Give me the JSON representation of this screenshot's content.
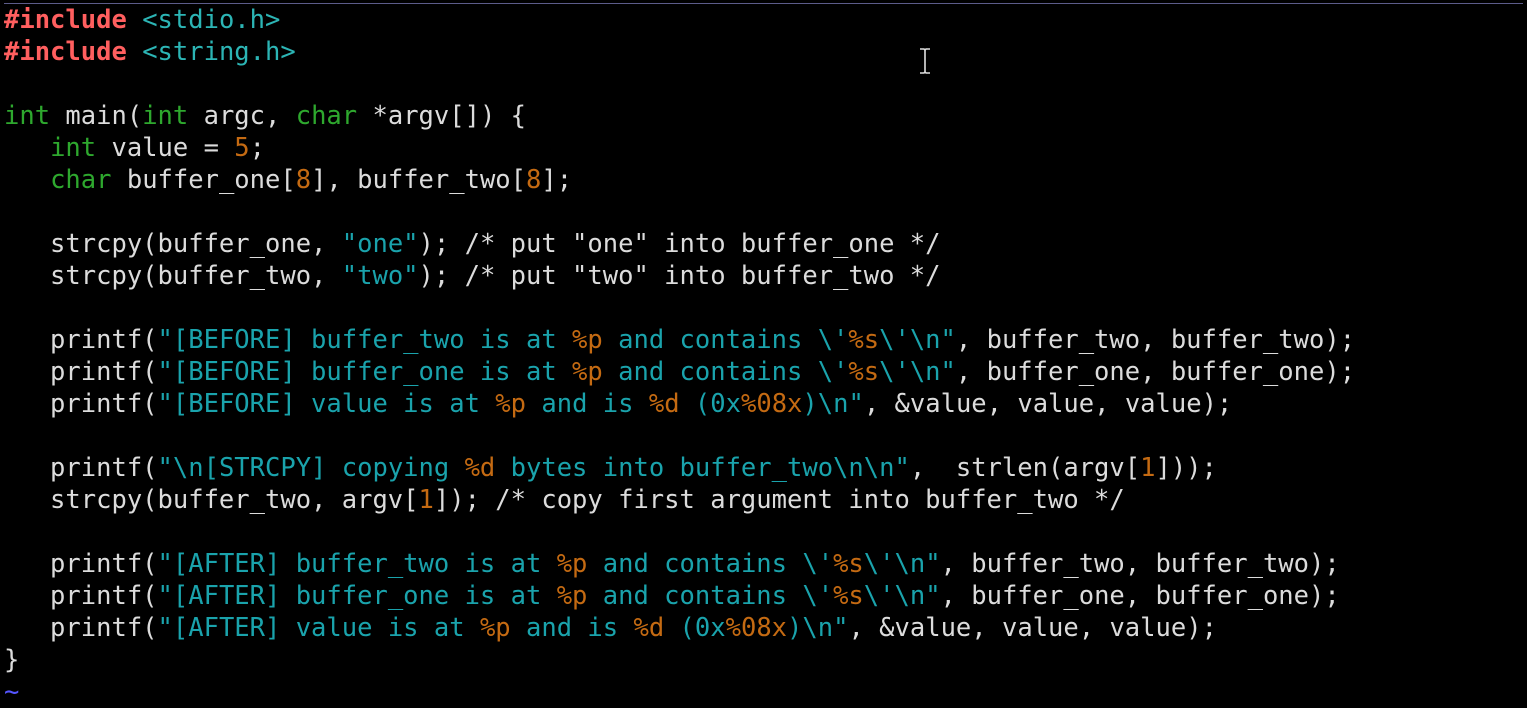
{
  "editor": {
    "colors": {
      "background": "#000000",
      "text": "#dcdcdc",
      "preprocessor": "#ff5f5f",
      "include_path": "#2cb5b5",
      "keyword": "#2ea82e",
      "number": "#c46a12",
      "string": "#1aa3ac",
      "format_specifier": "#c46a12",
      "tilde": "#5555ff"
    },
    "cursor_icon": "text-cursor-icon",
    "lines": [
      [
        {
          "t": "#include",
          "c": "pp"
        },
        {
          "t": " "
        },
        {
          "t": "<stdio.h>",
          "c": "inc"
        }
      ],
      [
        {
          "t": "#include",
          "c": "pp"
        },
        {
          "t": " "
        },
        {
          "t": "<string.h>",
          "c": "inc"
        }
      ],
      [],
      [
        {
          "t": "int",
          "c": "kw"
        },
        {
          "t": " main("
        },
        {
          "t": "int",
          "c": "kw"
        },
        {
          "t": " argc, "
        },
        {
          "t": "char",
          "c": "kw"
        },
        {
          "t": " *argv[]) {"
        }
      ],
      [
        {
          "t": "   "
        },
        {
          "t": "int",
          "c": "kw"
        },
        {
          "t": " value = "
        },
        {
          "t": "5",
          "c": "num"
        },
        {
          "t": ";"
        }
      ],
      [
        {
          "t": "   "
        },
        {
          "t": "char",
          "c": "kw"
        },
        {
          "t": " buffer_one["
        },
        {
          "t": "8",
          "c": "num"
        },
        {
          "t": "], buffer_two["
        },
        {
          "t": "8",
          "c": "num"
        },
        {
          "t": "];"
        }
      ],
      [],
      [
        {
          "t": "   strcpy(buffer_one, "
        },
        {
          "t": "\"one\"",
          "c": "str"
        },
        {
          "t": "); /* put \"one\" into buffer_one */"
        }
      ],
      [
        {
          "t": "   strcpy(buffer_two, "
        },
        {
          "t": "\"two\"",
          "c": "str"
        },
        {
          "t": "); /* put \"two\" into buffer_two */"
        }
      ],
      [],
      [
        {
          "t": "   printf("
        },
        {
          "t": "\"[BEFORE] buffer_two is at ",
          "c": "str"
        },
        {
          "t": "%p",
          "c": "fmt"
        },
        {
          "t": " and contains \\'",
          "c": "str"
        },
        {
          "t": "%s",
          "c": "fmt"
        },
        {
          "t": "\\'\\n\"",
          "c": "str"
        },
        {
          "t": ", buffer_two, buffer_two);"
        }
      ],
      [
        {
          "t": "   printf("
        },
        {
          "t": "\"[BEFORE] buffer_one is at ",
          "c": "str"
        },
        {
          "t": "%p",
          "c": "fmt"
        },
        {
          "t": " and contains \\'",
          "c": "str"
        },
        {
          "t": "%s",
          "c": "fmt"
        },
        {
          "t": "\\'\\n\"",
          "c": "str"
        },
        {
          "t": ", buffer_one, buffer_one);"
        }
      ],
      [
        {
          "t": "   printf("
        },
        {
          "t": "\"[BEFORE] value is at ",
          "c": "str"
        },
        {
          "t": "%p",
          "c": "fmt"
        },
        {
          "t": " and is ",
          "c": "str"
        },
        {
          "t": "%d",
          "c": "fmt"
        },
        {
          "t": " (0x",
          "c": "str"
        },
        {
          "t": "%08x",
          "c": "fmt"
        },
        {
          "t": ")\\n\"",
          "c": "str"
        },
        {
          "t": ", &value, value, value);"
        }
      ],
      [],
      [
        {
          "t": "   printf("
        },
        {
          "t": "\"\\n[STRCPY] copying ",
          "c": "str"
        },
        {
          "t": "%d",
          "c": "fmt"
        },
        {
          "t": " bytes into buffer_two\\n\\n\"",
          "c": "str"
        },
        {
          "t": ",  strlen(argv["
        },
        {
          "t": "1",
          "c": "num"
        },
        {
          "t": "]));"
        }
      ],
      [
        {
          "t": "   strcpy(buffer_two, argv["
        },
        {
          "t": "1",
          "c": "num"
        },
        {
          "t": "]); /* copy first argument into buffer_two */"
        }
      ],
      [],
      [
        {
          "t": "   printf("
        },
        {
          "t": "\"[AFTER] buffer_two is at ",
          "c": "str"
        },
        {
          "t": "%p",
          "c": "fmt"
        },
        {
          "t": " and contains \\'",
          "c": "str"
        },
        {
          "t": "%s",
          "c": "fmt"
        },
        {
          "t": "\\'\\n\"",
          "c": "str"
        },
        {
          "t": ", buffer_two, buffer_two);"
        }
      ],
      [
        {
          "t": "   printf("
        },
        {
          "t": "\"[AFTER] buffer_one is at ",
          "c": "str"
        },
        {
          "t": "%p",
          "c": "fmt"
        },
        {
          "t": " and contains \\'",
          "c": "str"
        },
        {
          "t": "%s",
          "c": "fmt"
        },
        {
          "t": "\\'\\n\"",
          "c": "str"
        },
        {
          "t": ", buffer_one, buffer_one);"
        }
      ],
      [
        {
          "t": "   printf("
        },
        {
          "t": "\"[AFTER] value is at ",
          "c": "str"
        },
        {
          "t": "%p",
          "c": "fmt"
        },
        {
          "t": " and is ",
          "c": "str"
        },
        {
          "t": "%d",
          "c": "fmt"
        },
        {
          "t": " (0x",
          "c": "str"
        },
        {
          "t": "%08x",
          "c": "fmt"
        },
        {
          "t": ")\\n\"",
          "c": "str"
        },
        {
          "t": ", &value, value, value);"
        }
      ],
      [
        {
          "t": "}"
        }
      ],
      [
        {
          "t": "~",
          "c": "tilde"
        }
      ]
    ]
  }
}
